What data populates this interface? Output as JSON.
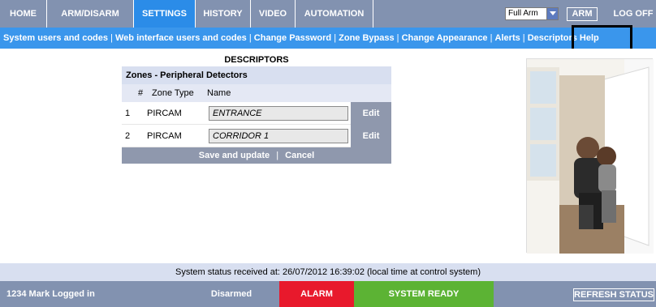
{
  "nav": {
    "tabs": [
      "HOME",
      "ARM/DISARM",
      "SETTINGS",
      "HISTORY",
      "VIDEO",
      "AUTOMATION"
    ],
    "active_tab": "SETTINGS",
    "arm_mode": "Full Arm",
    "arm_button": "ARM",
    "logoff": "LOG OFF"
  },
  "subnav": {
    "links": [
      "System users and codes",
      "Web interface users and codes",
      "Change Password",
      "Zone Bypass",
      "Change Appearance",
      "Alerts",
      "Descriptors",
      "Help"
    ],
    "separator": "|"
  },
  "descriptors": {
    "title": "DESCRIPTORS",
    "section": "Zones - Peripheral Detectors",
    "columns": [
      "#",
      "Zone Type",
      "Name"
    ],
    "rows": [
      {
        "num": "1",
        "type": "PIRCAM",
        "name": "ENTRANCE",
        "action": "Edit"
      },
      {
        "num": "2",
        "type": "PIRCAM",
        "name": "CORRIDOR 1",
        "action": "Edit"
      }
    ],
    "save_label": "Save and update",
    "cancel_label": "Cancel",
    "footer_sep": "|"
  },
  "status": {
    "message": "System status received at: 26/07/2012 16:39:02 (local time at control system)"
  },
  "bottom": {
    "user": "1234 Mark Logged in",
    "disarmed": "Disarmed",
    "alarm": "ALARM",
    "ready": "SYSTEM READY",
    "refresh": "REFRESH STATUS"
  },
  "colors": {
    "nav_bg": "#8292b0",
    "active_tab": "#2b8ce8",
    "subnav_bg": "#3a96ec",
    "alarm": "#e8192c",
    "ready": "#5cb334"
  }
}
